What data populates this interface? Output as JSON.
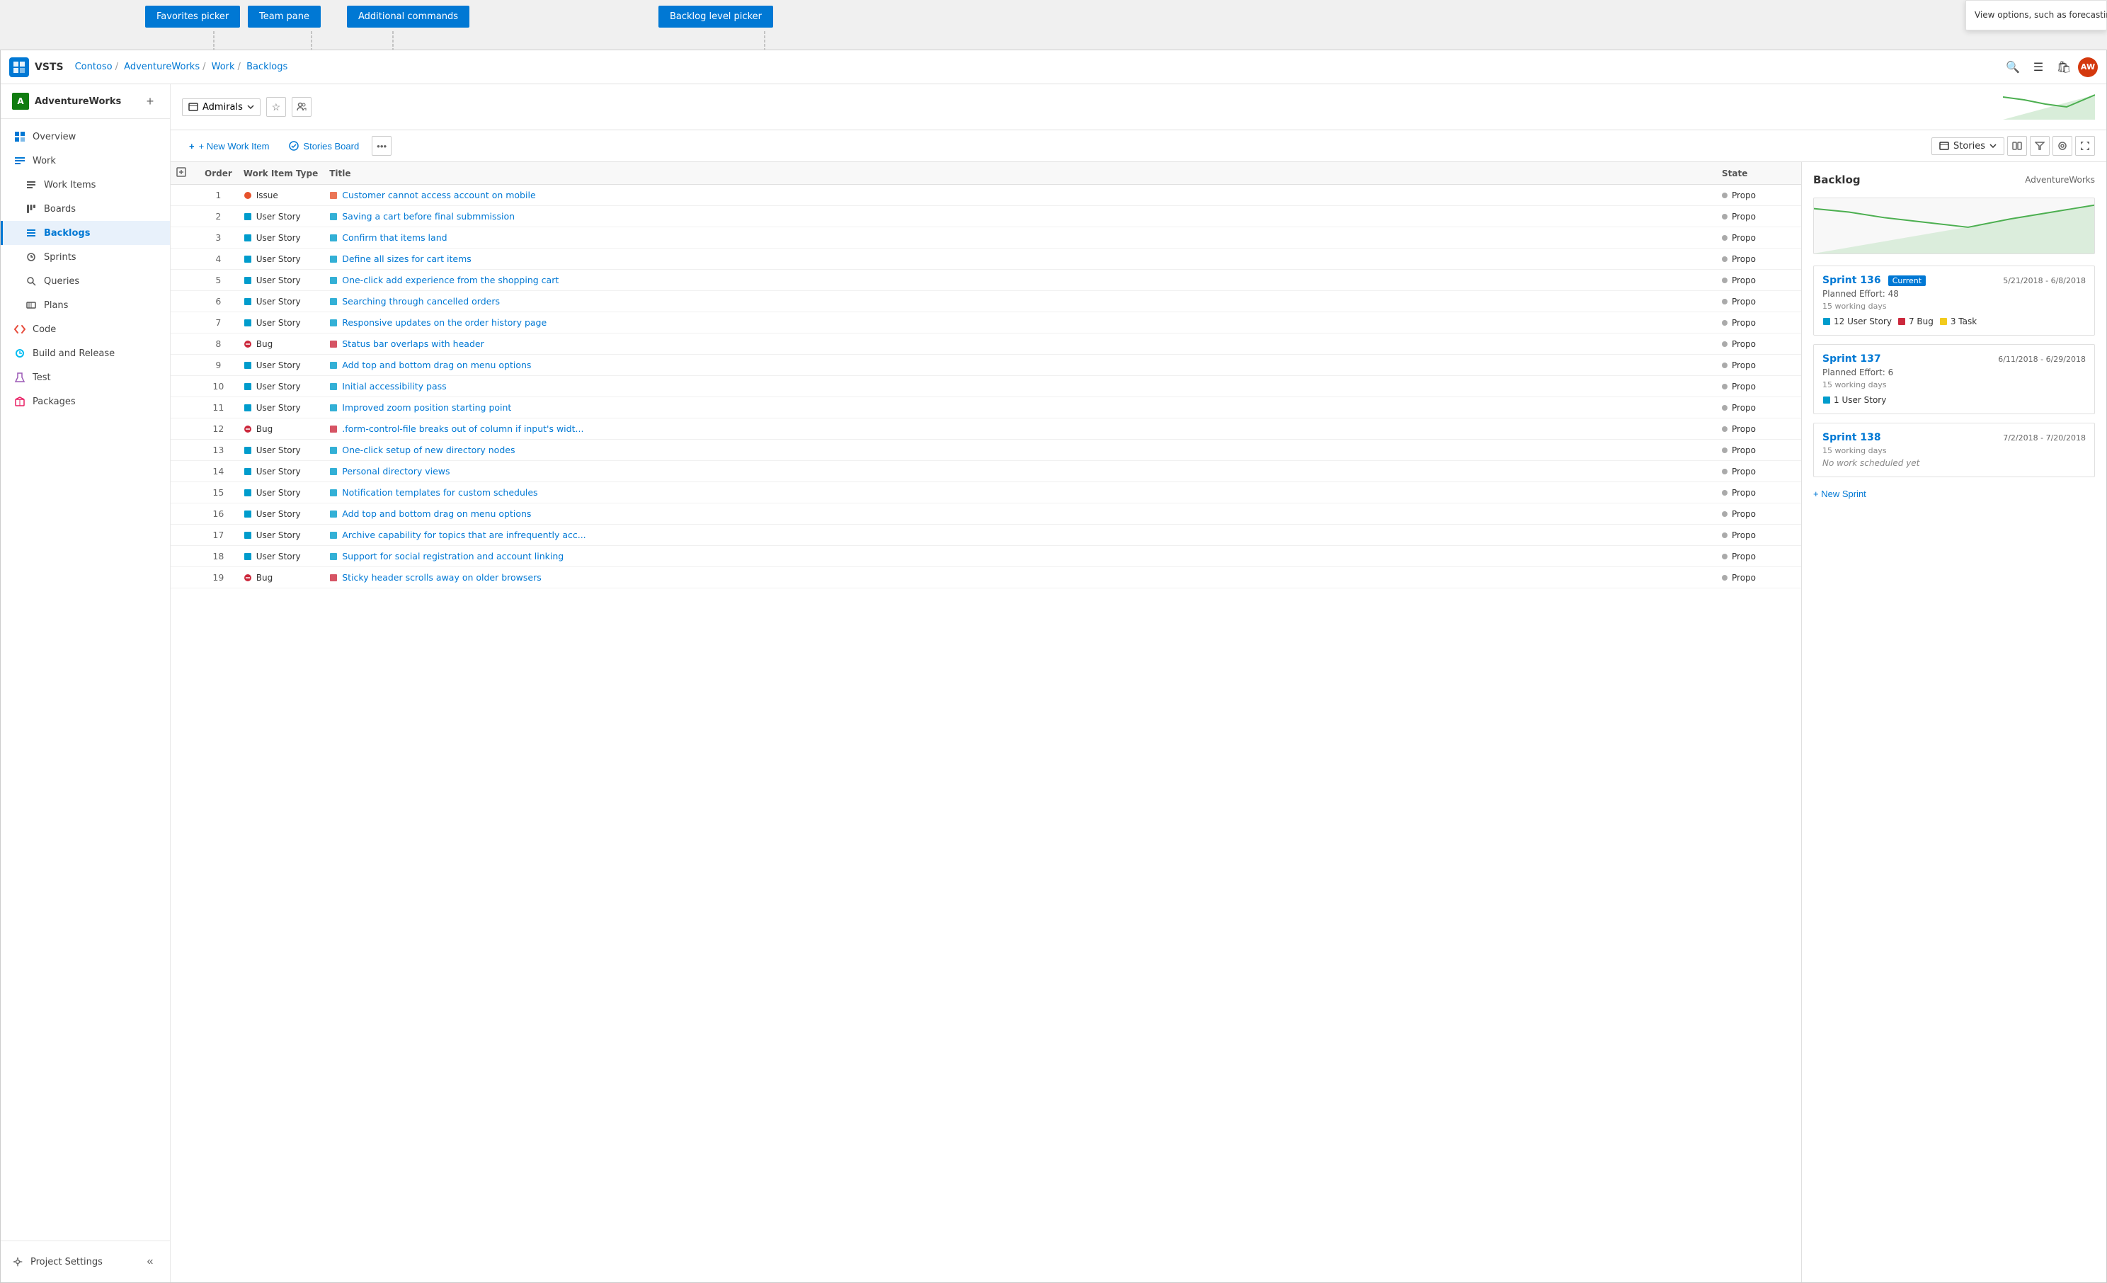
{
  "app": {
    "logo_text": "VS",
    "title": "VSTS",
    "breadcrumbs": [
      "Contoso",
      "AdventureWorks",
      "Work",
      "Backlogs"
    ]
  },
  "tooltip_banners": {
    "favorites": "Favorites picker",
    "team": "Team pane",
    "additional": "Additional commands",
    "backlog_level": "Backlog level picker",
    "view_options": "View options, such as forecasting and mapping"
  },
  "sidebar": {
    "org": {
      "name": "AdventureWorks",
      "avatar": "A"
    },
    "items": [
      {
        "id": "overview",
        "label": "Overview",
        "icon": "grid"
      },
      {
        "id": "work",
        "label": "Work",
        "icon": "work",
        "section_header": true
      },
      {
        "id": "work-items",
        "label": "Work Items",
        "icon": "list"
      },
      {
        "id": "boards",
        "label": "Boards",
        "icon": "boards"
      },
      {
        "id": "backlogs",
        "label": "Backlogs",
        "icon": "backlogs",
        "active": true
      },
      {
        "id": "sprints",
        "label": "Sprints",
        "icon": "sprints"
      },
      {
        "id": "queries",
        "label": "Queries",
        "icon": "queries"
      },
      {
        "id": "plans",
        "label": "Plans",
        "icon": "plans"
      },
      {
        "id": "code",
        "label": "Code",
        "icon": "code"
      },
      {
        "id": "build-release",
        "label": "Build and Release",
        "icon": "build"
      },
      {
        "id": "test",
        "label": "Test",
        "icon": "test"
      },
      {
        "id": "packages",
        "label": "Packages",
        "icon": "packages"
      }
    ],
    "bottom": {
      "label": "Project Settings",
      "icon": "settings"
    }
  },
  "toolbar": {
    "team_picker": "Admirals",
    "new_work_item": "+ New Work Item",
    "stories_board": "Stories Board",
    "more_label": "...",
    "stories_label": "Stories"
  },
  "table": {
    "headers": [
      "",
      "Order",
      "Work Item Type",
      "Title",
      "State"
    ],
    "rows": [
      {
        "order": 1,
        "type": "Issue",
        "type_color": "issue",
        "title": "Customer cannot access account on mobile",
        "state": "Propo"
      },
      {
        "order": 2,
        "type": "User Story",
        "type_color": "userstory",
        "title": "Saving a cart before final submmission",
        "state": "Propo"
      },
      {
        "order": 3,
        "type": "User Story",
        "type_color": "userstory",
        "title": "Confirm that items land",
        "state": "Propo"
      },
      {
        "order": 4,
        "type": "User Story",
        "type_color": "userstory",
        "title": "Define all sizes for cart items",
        "state": "Propo"
      },
      {
        "order": 5,
        "type": "User Story",
        "type_color": "userstory",
        "title": "One-click add experience from the shopping cart",
        "state": "Propo"
      },
      {
        "order": 6,
        "type": "User Story",
        "type_color": "userstory",
        "title": "Searching through cancelled orders",
        "state": "Propo"
      },
      {
        "order": 7,
        "type": "User Story",
        "type_color": "userstory",
        "title": "Responsive updates on the order history page",
        "state": "Propo"
      },
      {
        "order": 8,
        "type": "Bug",
        "type_color": "bug",
        "title": "Status bar overlaps with header",
        "state": "Propo"
      },
      {
        "order": 9,
        "type": "User Story",
        "type_color": "userstory",
        "title": "Add top and bottom drag on menu options",
        "state": "Propo"
      },
      {
        "order": 10,
        "type": "User Story",
        "type_color": "userstory",
        "title": "Initial accessibility pass",
        "state": "Propo"
      },
      {
        "order": 11,
        "type": "User Story",
        "type_color": "userstory",
        "title": "Improved zoom position starting point",
        "state": "Propo"
      },
      {
        "order": 12,
        "type": "Bug",
        "type_color": "bug",
        "title": ".form-control-file breaks out of column if input's widt...",
        "state": "Propo"
      },
      {
        "order": 13,
        "type": "User Story",
        "type_color": "userstory",
        "title": "One-click setup of new directory nodes",
        "state": "Propo"
      },
      {
        "order": 14,
        "type": "User Story",
        "type_color": "userstory",
        "title": "Personal directory views",
        "state": "Propo"
      },
      {
        "order": 15,
        "type": "User Story",
        "type_color": "userstory",
        "title": "Notification templates for custom schedules",
        "state": "Propo"
      },
      {
        "order": 16,
        "type": "User Story",
        "type_color": "userstory",
        "title": "Add top and bottom drag on menu options",
        "state": "Propo"
      },
      {
        "order": 17,
        "type": "User Story",
        "type_color": "userstory",
        "title": "Archive capability for topics that are infrequently acc...",
        "state": "Propo"
      },
      {
        "order": 18,
        "type": "User Story",
        "type_color": "userstory",
        "title": "Support for social registration and account linking",
        "state": "Propo"
      },
      {
        "order": 19,
        "type": "Bug",
        "type_color": "bug",
        "title": "Sticky header scrolls away on older browsers",
        "state": "Propo"
      }
    ]
  },
  "right_panel": {
    "title": "Backlog",
    "subtitle": "AdventureWorks",
    "sprints": [
      {
        "name": "Sprint 136",
        "badge": "Current",
        "dates": "5/21/2018 - 6/8/2018",
        "effort_label": "Planned Effort: 48",
        "working_days": "15 working days",
        "tags": [
          {
            "label": "12 User Story",
            "type": "userstory"
          },
          {
            "label": "7 Bug",
            "type": "bug"
          },
          {
            "label": "3 Task",
            "type": "task"
          }
        ]
      },
      {
        "name": "Sprint 137",
        "badge": "",
        "dates": "6/11/2018 - 6/29/2018",
        "effort_label": "Planned Effort: 6",
        "working_days": "15 working days",
        "tags": [
          {
            "label": "1 User Story",
            "type": "userstory"
          }
        ]
      },
      {
        "name": "Sprint 138",
        "badge": "",
        "dates": "7/2/2018 - 7/20/2018",
        "effort_label": "",
        "working_days": "15 working days",
        "empty_label": "No work scheduled yet",
        "tags": []
      }
    ],
    "new_sprint_label": "+ New Sprint"
  }
}
